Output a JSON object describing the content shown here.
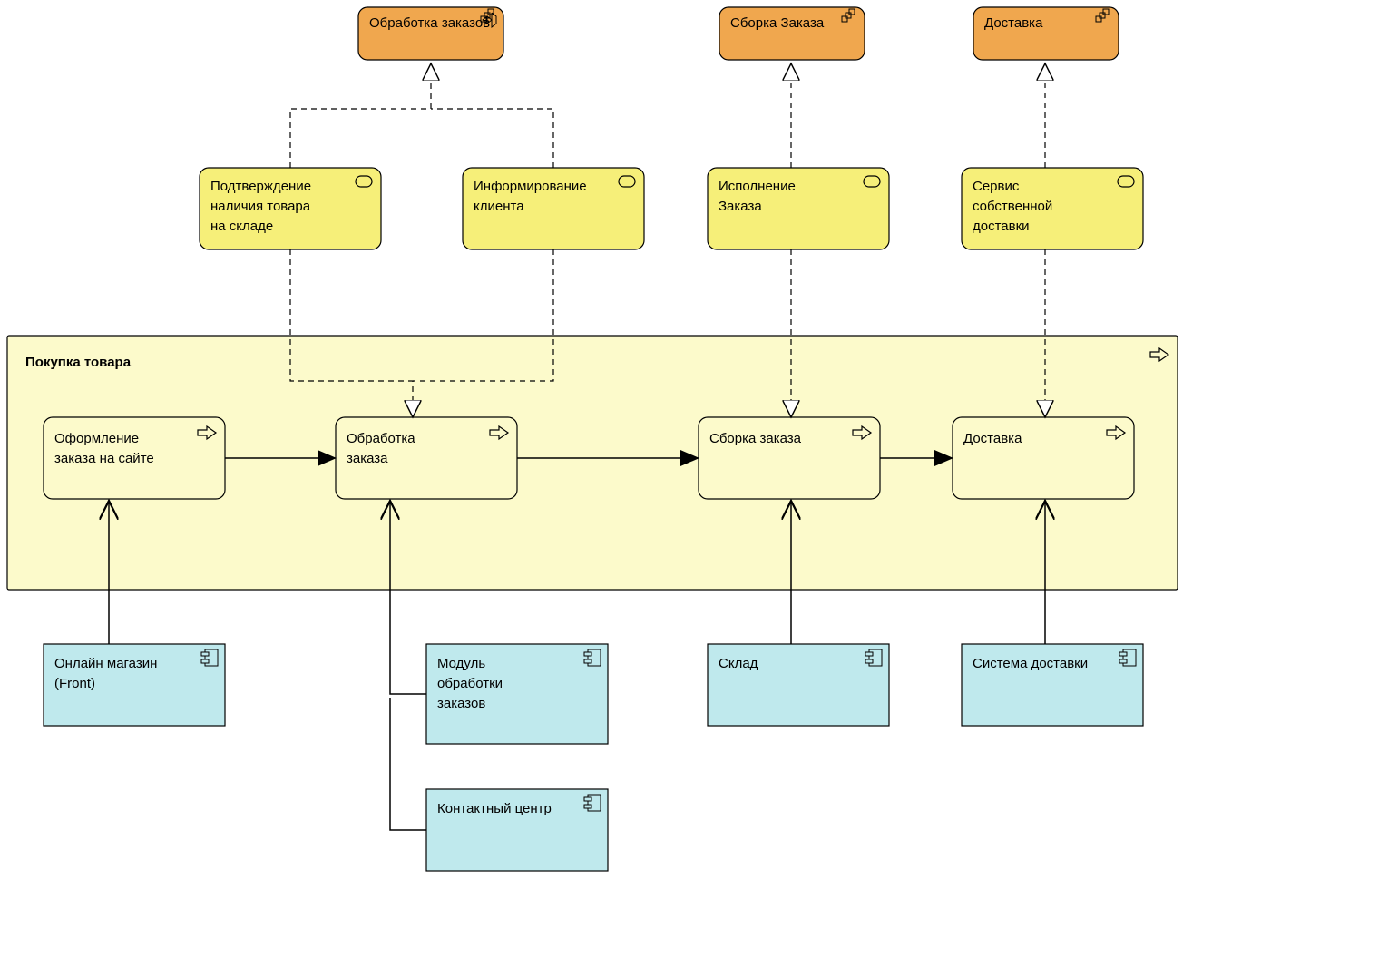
{
  "functions": {
    "f1": "Обработка заказов",
    "f2": "Сборка Заказа",
    "f3": "Доставка"
  },
  "services": {
    "s1_l1": "Подтверждение",
    "s1_l2": "наличия товара",
    "s1_l3": "на складе",
    "s2_l1": "Информирование",
    "s2_l2": "клиента",
    "s3_l1": "Исполнение",
    "s3_l2": "Заказа",
    "s4_l1": "Сервис",
    "s4_l2": "собственной",
    "s4_l3": "доставки"
  },
  "process": {
    "title": "Покупка товара",
    "p1_l1": "Оформление",
    "p1_l2": "заказа на сайте",
    "p2_l1": "Обработка",
    "p2_l2": "заказа",
    "p3": "Сборка заказа",
    "p4": "Доставка"
  },
  "apps": {
    "a1_l1": "Онлайн магазин",
    "a1_l2": "(Front)",
    "a2_l1": "Модуль",
    "a2_l2": "обработки",
    "a2_l3": "заказов",
    "a3": "Контактный центр",
    "a4": "Склад",
    "a5": "Система доставки"
  }
}
